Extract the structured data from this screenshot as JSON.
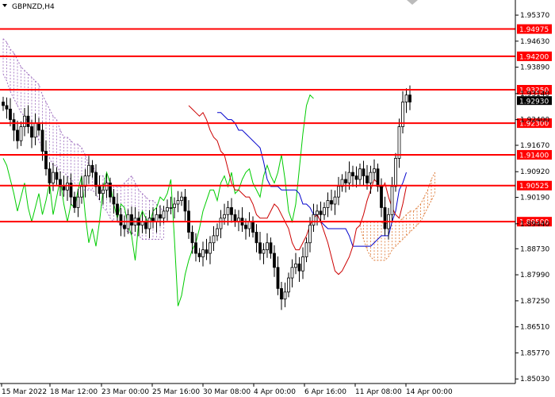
{
  "symbol_label": "GBPNZD,H4",
  "colors": {
    "background": "#ffffff",
    "axis": "#000000",
    "candle_up": "#000000",
    "candle_down": "#000000",
    "level_line": "#ff0000",
    "level_label_bg": "#ff0000",
    "level_label_text": "#ffffff",
    "kijun": "#0000cc",
    "tenkan": "#cc0000",
    "chikou": "#00cc00",
    "cloud_bear": "#a070c0",
    "cloud_bull": "#e08040",
    "current_price_bg": "#000000",
    "current_price_text": "#ffffff"
  },
  "price_axis": {
    "ticks": [
      "1.95370",
      "1.94630",
      "1.93890",
      "1.93140",
      "1.92400",
      "1.91670",
      "1.90920",
      "1.90190",
      "1.89440",
      "1.88730",
      "1.87990",
      "1.87250",
      "1.86510",
      "1.85770",
      "1.85030"
    ]
  },
  "time_axis": {
    "ticks": [
      "15 Mar 2022",
      "18 Mar 12:00",
      "23 Mar 00:00",
      "25 Mar 16:00",
      "30 Mar 08:00",
      "4 Apr 00:00",
      "6 Apr 16:00",
      "11 Apr 08:00",
      "14 Apr 00:00"
    ]
  },
  "levels": [
    "1.94975",
    "1.94200",
    "1.93250",
    "1.92300",
    "1.91400",
    "1.90525",
    "1.89500"
  ],
  "current_price": "1.92930",
  "chart_data": {
    "type": "candlestick",
    "title": "GBPNZD,H4",
    "ylim": [
      1.849,
      1.958
    ],
    "horizontal_levels": [
      1.94975,
      1.942,
      1.9325,
      1.923,
      1.914,
      1.90525,
      1.895
    ],
    "close_series": [
      1.928,
      1.927,
      1.924,
      1.921,
      1.918,
      1.922,
      1.925,
      1.922,
      1.919,
      1.923,
      1.921,
      1.915,
      1.91,
      1.906,
      1.909,
      1.907,
      1.905,
      1.904,
      1.906,
      1.902,
      1.899,
      1.902,
      1.905,
      1.908,
      1.911,
      1.909,
      1.905,
      1.903,
      1.904,
      1.906,
      1.902,
      1.9,
      1.897,
      1.894,
      1.893,
      1.897,
      1.894,
      1.896,
      1.894,
      1.895,
      1.893,
      1.896,
      1.895,
      1.897,
      1.896,
      1.898,
      1.899,
      1.899,
      1.9,
      1.901,
      1.902,
      1.898,
      1.892,
      1.889,
      1.886,
      1.885,
      1.887,
      1.886,
      1.889,
      1.891,
      1.893,
      1.896,
      1.897,
      1.899,
      1.897,
      1.895,
      1.896,
      1.894,
      1.893,
      1.895,
      1.892,
      1.889,
      1.886,
      1.887,
      1.889,
      1.886,
      1.882,
      1.876,
      1.873,
      1.875,
      1.879,
      1.882,
      1.883,
      1.881,
      1.885,
      1.889,
      1.894,
      1.897,
      1.898,
      1.897,
      1.899,
      1.901,
      1.9,
      1.902,
      1.905,
      1.907,
      1.906,
      1.909,
      1.908,
      1.907,
      1.91,
      1.908,
      1.906,
      1.909,
      1.91,
      1.905,
      1.899,
      1.893,
      1.897,
      1.905,
      1.913,
      1.922,
      1.929,
      1.931,
      1.929
    ],
    "kijun_series": [
      1.926,
      1.926,
      1.925,
      1.924,
      1.924,
      1.923,
      1.921,
      1.921,
      1.92,
      1.919,
      1.918,
      1.917,
      1.916,
      1.912,
      1.907,
      1.905,
      1.905,
      1.905,
      1.904,
      1.904,
      1.904,
      1.904,
      1.904,
      1.903,
      1.9,
      1.9,
      1.899,
      1.897,
      1.897,
      1.895,
      1.894,
      1.893,
      1.893,
      1.893,
      1.893,
      1.893,
      1.893,
      1.891,
      1.888,
      1.888,
      1.888,
      1.888,
      1.888,
      1.888,
      1.889,
      1.89,
      1.891,
      1.891,
      1.891,
      1.895,
      1.898,
      1.904,
      1.906,
      1.909
    ],
    "tenkan_series": [
      1.928,
      1.927,
      1.926,
      1.925,
      1.926,
      1.924,
      1.921,
      1.919,
      1.918,
      1.915,
      1.914,
      1.91,
      1.906,
      1.904,
      1.904,
      1.903,
      1.902,
      1.902,
      1.9,
      1.897,
      1.896,
      1.896,
      1.896,
      1.898,
      1.9,
      1.899,
      1.897,
      1.895,
      1.893,
      1.889,
      1.887,
      1.887,
      1.889,
      1.891,
      1.894,
      1.896,
      1.897,
      1.895,
      1.892,
      1.889,
      1.885,
      1.881,
      1.88,
      1.881,
      1.883,
      1.885,
      1.888,
      1.893,
      1.894,
      1.897,
      1.901,
      1.904,
      1.907,
      1.906,
      1.904,
      1.906,
      1.902,
      1.899,
      1.897,
      1.896,
      1.9,
      1.905
    ],
    "chikou_series": [
      1.913,
      1.911,
      1.907,
      1.903,
      1.898,
      1.902,
      1.906,
      1.899,
      1.895,
      1.899,
      1.903,
      1.897,
      1.901,
      1.906,
      1.897,
      1.902,
      1.907,
      1.9,
      1.895,
      1.9,
      1.899,
      1.904,
      1.908,
      1.897,
      1.889,
      1.893,
      1.888,
      1.895,
      1.904,
      1.909,
      1.906,
      1.9,
      1.896,
      1.9,
      1.899,
      1.894,
      1.891,
      1.884,
      1.895,
      1.898,
      1.896,
      1.894,
      1.898,
      1.899,
      1.902,
      1.901,
      1.903,
      1.907,
      1.89,
      1.871,
      1.874,
      1.88,
      1.884,
      1.887,
      1.889,
      1.893,
      1.898,
      1.901,
      1.904,
      1.904,
      1.901,
      1.906,
      1.908,
      1.905,
      1.909,
      1.903,
      1.904,
      1.907,
      1.909,
      1.91,
      1.906,
      1.904,
      1.902,
      1.908,
      1.911,
      1.908,
      1.906,
      1.909,
      1.914,
      1.907,
      1.898,
      1.895,
      1.9,
      1.91,
      1.92,
      1.928,
      1.931,
      1.93
    ],
    "cloud_bear": {
      "upper": [
        1.947,
        1.946,
        1.944,
        1.943,
        1.941,
        1.939,
        1.938,
        1.937,
        1.936,
        1.935,
        1.934,
        1.931,
        1.929,
        1.927,
        1.925,
        1.924,
        1.921,
        1.919,
        1.919,
        1.918,
        1.917,
        1.917,
        1.916,
        1.914,
        1.911,
        1.911,
        1.909,
        1.908,
        1.908,
        1.906,
        1.906,
        1.905,
        1.905,
        1.905,
        1.906,
        1.907,
        1.908,
        1.906,
        1.904,
        1.903,
        1.902,
        1.901,
        1.901,
        1.9,
        1.899,
        1.898
      ],
      "lower": [
        1.937,
        1.935,
        1.932,
        1.93,
        1.928,
        1.926,
        1.925,
        1.923,
        1.921,
        1.921,
        1.918,
        1.916,
        1.914,
        1.913,
        1.911,
        1.911,
        1.909,
        1.909,
        1.908,
        1.907,
        1.906,
        1.905,
        1.904,
        1.904,
        1.904,
        1.904,
        1.903,
        1.901,
        1.899,
        1.898,
        1.896,
        1.895,
        1.895,
        1.894,
        1.893,
        1.892,
        1.892,
        1.891,
        1.891,
        1.89,
        1.89,
        1.89,
        1.89,
        1.89,
        1.89,
        1.89
      ]
    },
    "cloud_bull": {
      "upper": [
        1.895,
        1.895,
        1.895,
        1.895,
        1.895,
        1.895,
        1.895,
        1.894,
        1.895,
        1.895,
        1.895,
        1.895,
        1.896,
        1.897,
        1.898,
        1.898,
        1.899,
        1.9,
        1.902,
        1.904,
        1.907,
        1.909
      ],
      "lower": [
        1.894,
        1.89,
        1.887,
        1.885,
        1.884,
        1.884,
        1.884,
        1.884,
        1.885,
        1.887,
        1.888,
        1.889,
        1.89,
        1.891,
        1.892,
        1.893,
        1.894,
        1.895,
        1.897,
        1.899,
        1.901,
        1.903
      ]
    }
  }
}
